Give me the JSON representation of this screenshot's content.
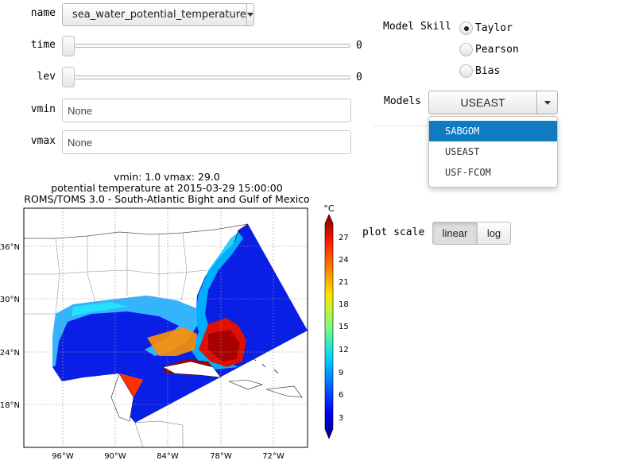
{
  "controls": {
    "name": {
      "label": "name",
      "value": "sea_water_potential_temperature"
    },
    "time": {
      "label": "time",
      "readout": "0"
    },
    "lev": {
      "label": "lev",
      "readout": "0"
    },
    "vmin": {
      "label": "vmin",
      "value": "None"
    },
    "vmax": {
      "label": "vmax",
      "value": "None"
    }
  },
  "skill": {
    "label": "Model Skill",
    "options": [
      "Taylor",
      "Pearson",
      "Bias"
    ],
    "selected": "Taylor"
  },
  "models": {
    "label": "Models",
    "value": "USEAST",
    "options": [
      "SABGOM",
      "USEAST",
      "USF-FCOM"
    ],
    "highlighted": "SABGOM"
  },
  "scale": {
    "label": "plot scale",
    "options": [
      "linear",
      "log"
    ],
    "selected": "linear"
  },
  "plot": {
    "title_lines": [
      "vmin: 1.0 vmax: 29.0",
      "potential temperature at 2015-03-29 15:00:00",
      "ROMS/TOMS 3.0 - South-Atlantic Bight and Gulf of Mexico"
    ],
    "lon_labels": [
      "96°W",
      "90°W",
      "84°W",
      "78°W",
      "72°W"
    ],
    "lat_labels": [
      "36°N",
      "30°N",
      "24°N",
      "18°N"
    ],
    "colorbar_unit": "°C",
    "colorbar_ticks": [
      "27",
      "24",
      "21",
      "18",
      "15",
      "12",
      "9",
      "6",
      "3"
    ]
  },
  "chart_data": {
    "type": "heatmap",
    "title": "vmin: 1.0 vmax: 29.0 / potential temperature at 2015-03-29 15:00:00 / ROMS/TOMS 3.0 - South-Atlantic Bight and Gulf of Mexico",
    "colorbar": {
      "unit": "°C",
      "min": 1.0,
      "max": 29.0,
      "ticks": [
        3,
        6,
        9,
        12,
        15,
        18,
        21,
        24,
        27
      ]
    },
    "x_ticks": [
      "96°W",
      "90°W",
      "84°W",
      "78°W",
      "72°W"
    ],
    "y_ticks": [
      "36°N",
      "30°N",
      "24°N",
      "18°N"
    ],
    "grid": true
  }
}
